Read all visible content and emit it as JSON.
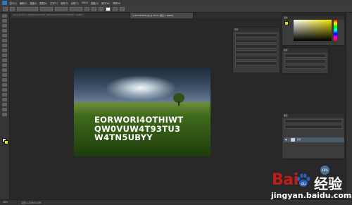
{
  "menu": {
    "items": [
      "文件(F)",
      "编辑(E)",
      "图像(I)",
      "图层(L)",
      "文字(Y)",
      "选择(S)",
      "滤镜(T)",
      "3D(D)",
      "视图(V)",
      "窗口(W)",
      "帮助(H)"
    ]
  },
  "tabs": [
    {
      "label": "t2.jpg @ 48.5% (EORWORI4OTHIWT QW0VUW4T93TU3 W4TN5UBYY, RGB/8) *",
      "active": false
    },
    {
      "label": "u=1875859930.jpg @ 48.5% (图层 1, RGB/8)",
      "active": true
    }
  ],
  "document": {
    "text_lines": [
      "EORWORI4OTHIWT",
      "QW0VUW4T93TU3",
      "W4TN5UBYY"
    ]
  },
  "status": {
    "zoom": "48%",
    "doc_size": "文档:1.12M/3.02M"
  },
  "zoom_badge": "48%",
  "panels": {
    "character_title": "字符",
    "paragraph_title": "段落",
    "color_title": "颜色",
    "layers_title": "图层",
    "layer_name": "背景"
  },
  "watermark": {
    "brand": "Bai",
    "cn": "经验",
    "url": "jingyan.baidu.com"
  },
  "colors": {
    "foreground": "#ffffff",
    "background": "#e8e000"
  }
}
